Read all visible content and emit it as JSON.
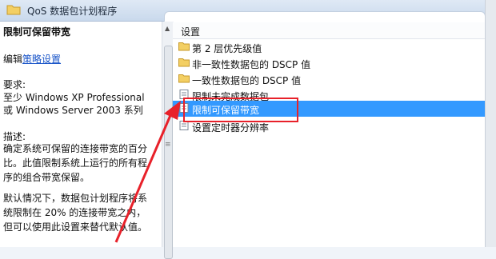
{
  "window": {
    "title": "QoS 数据包计划程序"
  },
  "left_pane": {
    "heading": "限制可保留带宽",
    "edit_prefix": "编辑",
    "edit_link": "策略设置",
    "req_label": "要求:",
    "req_line1": "至少 Windows XP Professional",
    "req_line2": "或 Windows Server 2003 系列",
    "desc_label": "描述:",
    "desc_line1": "确定系统可保留的连接带宽的百分",
    "desc_line2": "比。此值限制系统上运行的所有程",
    "desc_line3": "序的组合带宽保留。",
    "desc_line4": "默认情况下，数据包计划程序将系",
    "desc_line5": "统限制在 20% 的连接带宽之内，",
    "desc_line6": "但可以使用此设置来替代默认值。"
  },
  "right_pane": {
    "column_header": "设置",
    "items": [
      {
        "label": "第 2 层优先级值",
        "icon": "folder-icon"
      },
      {
        "label": "非一致性数据包的 DSCP 值",
        "icon": "folder-icon"
      },
      {
        "label": "一致性数据包的 DSCP 值",
        "icon": "folder-icon"
      },
      {
        "label": "限制未完成数据包",
        "icon": "setting-page-icon"
      },
      {
        "label": "限制可保留带宽",
        "icon": "setting-page-icon",
        "selected": true
      },
      {
        "label": "设置定时器分辨率",
        "icon": "setting-page-icon"
      }
    ]
  },
  "colors": {
    "selection": "#3399ff",
    "annotation": "#e8212a",
    "link": "#1a55c8"
  }
}
